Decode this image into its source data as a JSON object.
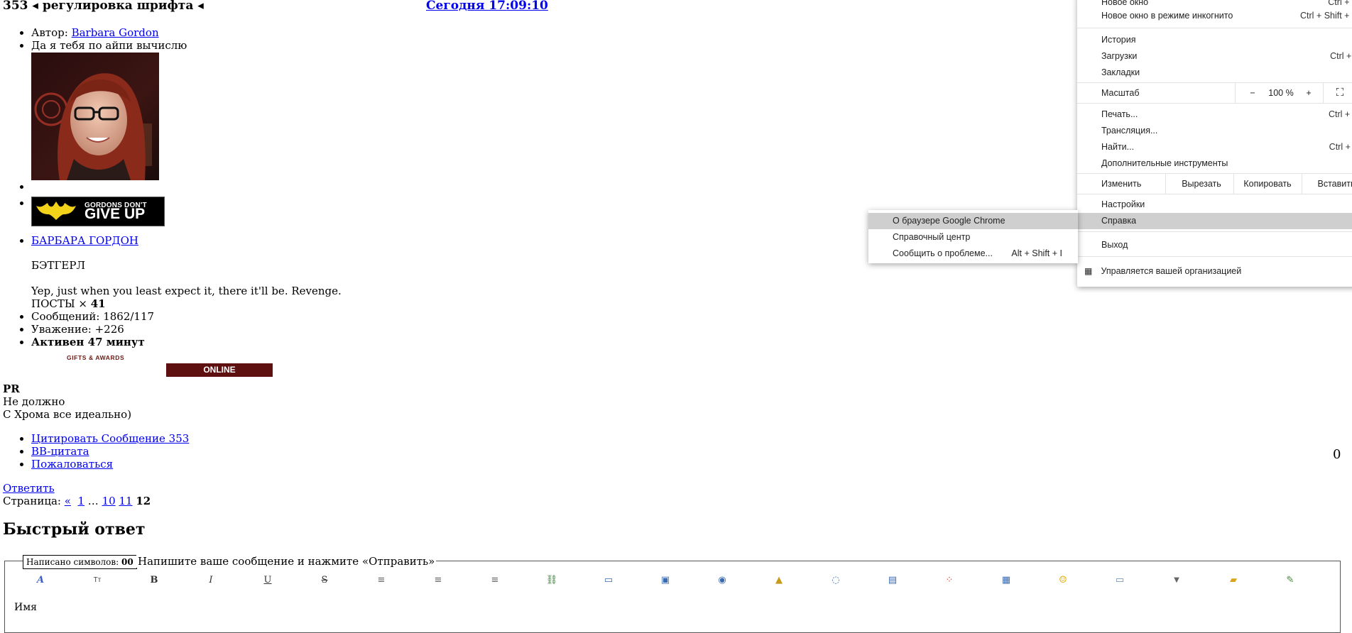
{
  "post": {
    "number_title": "353 ◂ регулировка шрифта ◂",
    "date_link": "Сегодня 17:09:10",
    "author_label": "Автор: ",
    "author_name": "Barbara Gordon",
    "status_text": "Да я тебя по айпи вычислю",
    "banner_line1": "GORDONS DON'T",
    "banner_line2": "GIVE UP",
    "profile_link": "БАРБАРА ГОРДОН",
    "role": "БЭТГЕРЛ",
    "quote": "Yep, just when you least expect it, there it'll be. Revenge.",
    "posts_label": "ПОСТЫ × ",
    "posts_count": "41",
    "messages": "Сообщений: 1862/117",
    "respect": "Уважение: +226",
    "active": "Активен 47 минут",
    "gifts": "GIFTS & AWARDS",
    "online": "ONLINE",
    "body_title": "PR",
    "body_line1": "Не должно",
    "body_line2": "С Хрома все идеально)",
    "actions": [
      "Цитировать Сообщение 353",
      "BB-цитата",
      "Пожаловаться"
    ],
    "counter_right": "0"
  },
  "reply_link": "Ответить",
  "pagination": {
    "label": "Страница: ",
    "prev": "«",
    "p1": "1",
    "ellipsis": " … ",
    "p10": "10",
    "p11": "11",
    "current": "12"
  },
  "quick_reply": {
    "heading": "Быстрый ответ",
    "counter_label": "Написано символов: ",
    "counter_value": "00",
    "instruction": "Напишите ваше сообщение и нажмите «Отправить»",
    "name_label": "Имя",
    "toolbar_icons": [
      "font-icon",
      "size-icon",
      "bold-icon",
      "italic-icon",
      "underline-icon",
      "strike-icon",
      "align-left-icon",
      "align-center-icon",
      "align-right-icon",
      "link-icon",
      "book-icon",
      "spoiler-icon",
      "video-icon",
      "lock-icon",
      "speech-bubble-icon",
      "hide-icon",
      "color-icon",
      "table-icon",
      "smiley-icon",
      "image-icon",
      "more-dropdown-icon",
      "upload-icon",
      "edit-icon"
    ]
  },
  "chrome_menu": {
    "new_window": "Новое окно",
    "new_window_sc": "Ctrl + N",
    "incognito": "Новое окно в режиме инкогнито",
    "incognito_sc": "Ctrl + Shift + N",
    "history": "История",
    "downloads": "Загрузки",
    "downloads_sc": "Ctrl + J",
    "bookmarks": "Закладки",
    "zoom_label": "Масштаб",
    "zoom_minus": "−",
    "zoom_value": "100 %",
    "zoom_plus": "+",
    "print": "Печать...",
    "print_sc": "Ctrl + P",
    "cast": "Трансляция...",
    "find": "Найти...",
    "find_sc": "Ctrl + F",
    "more_tools": "Дополнительные инструменты",
    "edit": "Изменить",
    "cut": "Вырезать",
    "copy": "Копировать",
    "paste": "Вставить",
    "settings": "Настройки",
    "help": "Справка",
    "exit": "Выход",
    "managed": "Управляется вашей организацией"
  },
  "help_submenu": {
    "about": "О браузере Google Chrome",
    "help_center": "Справочный центр",
    "report": "Сообщить о проблеме...",
    "report_sc": "Alt + Shift + I"
  }
}
